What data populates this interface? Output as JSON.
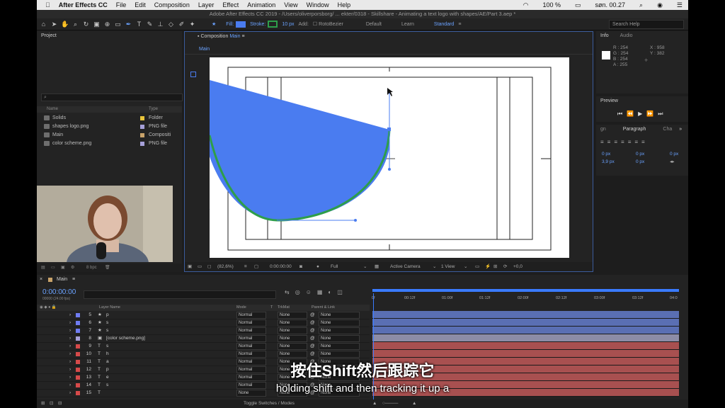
{
  "menubar": {
    "app_name": "After Effects CC",
    "items": [
      "File",
      "Edit",
      "Composition",
      "Layer",
      "Effect",
      "Animation",
      "View",
      "Window",
      "Help"
    ],
    "battery": "100 %",
    "clock": "søn. 00.27"
  },
  "window_title": "Adobe After Effects CC 2019 - /Users/oliverporsborg/ ... ekter/0318 - Skillshare - Animating a text logo with shapes/AE/Part 3.aep *",
  "toolbar": {
    "fill_label": "Fill:",
    "stroke_label": "Stroke:",
    "stroke_width": "10 px",
    "add_label": "Add:",
    "rotobezier_label": "RotoBezier",
    "workspaces": [
      "Default",
      "Learn",
      "Standard"
    ],
    "search_placeholder": "Search Help",
    "colors": {
      "fill": "#4a7cf0",
      "stroke": "#2e9e4a"
    }
  },
  "project": {
    "title": "Project",
    "columns": {
      "name": "Name",
      "type": "Type"
    },
    "rows": [
      {
        "name": "Solids",
        "type": "Folder",
        "label_color": "#e8c43a"
      },
      {
        "name": "shapes logo.png",
        "type": "PNG file",
        "label_color": "#a6a0d8"
      },
      {
        "name": "Main",
        "type": "Compositi",
        "label_color": "#c9a36a"
      },
      {
        "name": "color scheme.png",
        "type": "PNG file",
        "label_color": "#a6a0d8"
      }
    ],
    "bpc": "8 bpc"
  },
  "composition": {
    "title_prefix": "Composition",
    "title_name": "Main",
    "tab": "Main",
    "footer": {
      "zoom": "(82,6%)",
      "timecode": "0:00:00:00",
      "resolution": "Full",
      "camera": "Active Camera",
      "view": "1 View",
      "exposure": "+0,0"
    }
  },
  "info_panel": {
    "tabs": [
      "Info",
      "Audio"
    ],
    "r": "R : 254",
    "g": "G : 254",
    "b": "B : 254",
    "a": "A : 255",
    "x": "X : 958",
    "y": "Y : 382"
  },
  "preview_panel": {
    "title": "Preview"
  },
  "paragraph_panel": {
    "tabs": [
      "gn",
      "Paragraph",
      "Cha"
    ],
    "fields": [
      "0 px",
      "0 px",
      "0 px",
      "3,9 px",
      "0 px",
      "0 px"
    ]
  },
  "timeline": {
    "tab": "Main",
    "timecode": "0:00:00:00",
    "fps": "00000 (24.00 fps)",
    "columns": {
      "layer_name": "Layer Name",
      "mode": "Mode",
      "t": "T",
      "trkmat": "TrkMat",
      "parent": "Parent & Link"
    },
    "ruler": [
      "0f",
      "00:12f",
      "01:00f",
      "01:12f",
      "02:00f",
      "02:12f",
      "03:00f",
      "03:12f",
      "04:0"
    ],
    "layers": [
      {
        "num": "5",
        "type": "★",
        "name": "p",
        "mode": "Normal",
        "trkmat": "None",
        "parent": "None",
        "label_color": "#6f7cf2",
        "bar_color": "#5a6fb3"
      },
      {
        "num": "6",
        "type": "★",
        "name": "s",
        "mode": "Normal",
        "trkmat": "None",
        "parent": "None",
        "label_color": "#6f7cf2",
        "bar_color": "#5a6fb3"
      },
      {
        "num": "7",
        "type": "★",
        "name": "s",
        "mode": "Normal",
        "trkmat": "None",
        "parent": "None",
        "label_color": "#6f7cf2",
        "bar_color": "#5a6fb3"
      },
      {
        "num": "8",
        "type": "▣",
        "name": "[color scheme.png]",
        "mode": "Normal",
        "trkmat": "None",
        "parent": "None",
        "label_color": "#a6a0d8",
        "bar_color": "#8c8ca6"
      },
      {
        "num": "9",
        "type": "T",
        "name": "s",
        "mode": "Normal",
        "trkmat": "None",
        "parent": "None",
        "label_color": "#d64a4a",
        "bar_color": "#a85050"
      },
      {
        "num": "10",
        "type": "T",
        "name": "h",
        "mode": "Normal",
        "trkmat": "None",
        "parent": "None",
        "label_color": "#d64a4a",
        "bar_color": "#a85050"
      },
      {
        "num": "11",
        "type": "T",
        "name": "a",
        "mode": "Normal",
        "trkmat": "None",
        "parent": "None",
        "label_color": "#d64a4a",
        "bar_color": "#a85050"
      },
      {
        "num": "12",
        "type": "T",
        "name": "p",
        "mode": "Normal",
        "trkmat": "None",
        "parent": "None",
        "label_color": "#d64a4a",
        "bar_color": "#a85050"
      },
      {
        "num": "13",
        "type": "T",
        "name": "e",
        "mode": "Normal",
        "trkmat": "None",
        "parent": "None",
        "label_color": "#d64a4a",
        "bar_color": "#a85050"
      },
      {
        "num": "14",
        "type": "T",
        "name": "s",
        "mode": "Normal",
        "trkmat": "None",
        "parent": "None",
        "label_color": "#d64a4a",
        "bar_color": "#a85050"
      },
      {
        "num": "15",
        "type": "T",
        "name": "",
        "mode": "None",
        "trkmat": "None",
        "parent": "None",
        "label_color": "#d64a4a",
        "bar_color": "#a85050"
      }
    ],
    "footer_toggle": "Toggle Switches / Modes"
  },
  "subtitles": {
    "zh": "按住Shift然后跟踪它",
    "en": "holding shift and then tracking it up a"
  }
}
